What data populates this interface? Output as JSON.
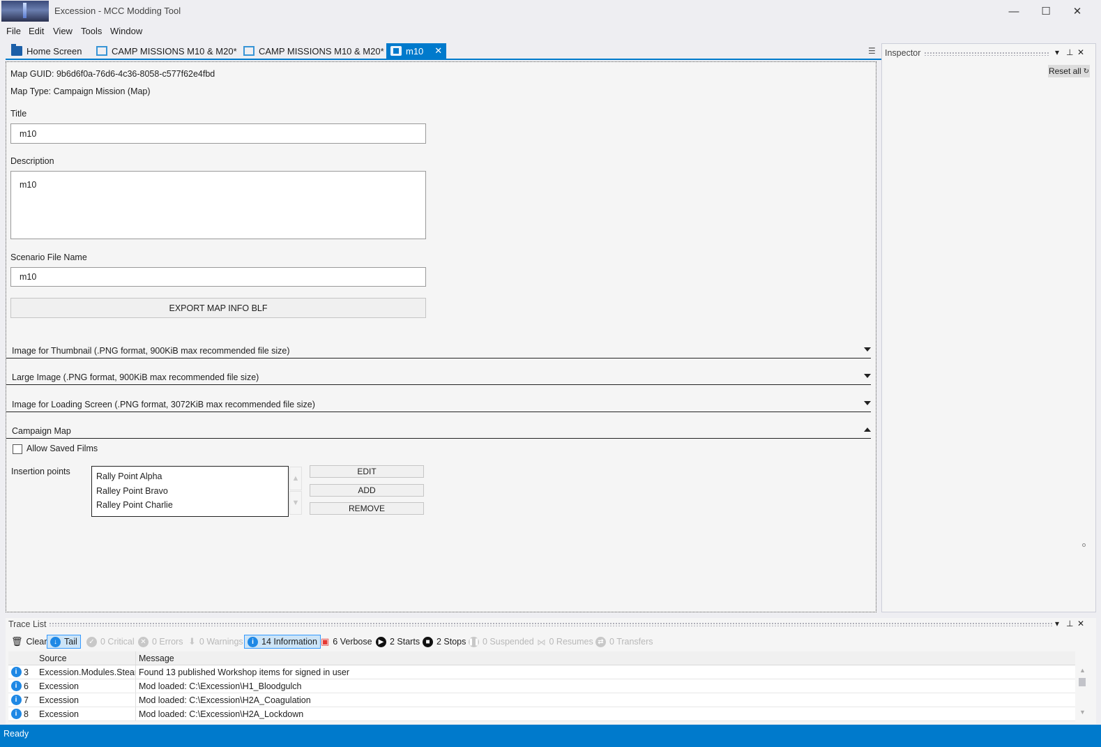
{
  "window": {
    "title": "Excession - MCC Modding Tool",
    "controls": {
      "minimize": "—",
      "maximize": "☐",
      "close": "✕"
    }
  },
  "menu": [
    "File",
    "Edit",
    "View",
    "Tools",
    "Window"
  ],
  "tabs": [
    {
      "label": "Home Screen",
      "icon": "folder-icon"
    },
    {
      "label": "CAMP MISSIONS M10 & M20*",
      "icon": "package-icon"
    },
    {
      "label": "CAMP MISSIONS M10 & M20*",
      "icon": "package-icon"
    },
    {
      "label": "m10",
      "icon": "puzzle-icon",
      "active": true
    }
  ],
  "map": {
    "guid": "Map GUID: 9b6d6f0a-76d6-4c36-8058-c577f62e4fbd",
    "type": "Map Type: Campaign Mission (Map)",
    "title_label": "Title",
    "title_value": "m10",
    "description_label": "Description",
    "description_value": "m10",
    "scenario_label": "Scenario File Name",
    "scenario_value": "m10",
    "export_label": "EXPORT MAP INFO BLF"
  },
  "sections": [
    {
      "label": "Image for Thumbnail (.PNG format, 900KiB max recommended file size)",
      "expanded": false
    },
    {
      "label": "Large Image (.PNG format, 900KiB max recommended file size)",
      "expanded": false
    },
    {
      "label": "Image for Loading Screen (.PNG format, 3072KiB max recommended file size)",
      "expanded": false
    },
    {
      "label": "Campaign Map",
      "expanded": true
    }
  ],
  "campaign": {
    "allow_saved_films": "Allow Saved Films",
    "insertion_label": "Insertion points",
    "insertion_points": [
      "Rally Point Alpha",
      "Ralley Point Bravo",
      "Ralley Point Charlie"
    ],
    "edit": "EDIT",
    "add": "ADD",
    "remove": "REMOVE"
  },
  "inspector": {
    "title": "Inspector",
    "reset_all": "Reset all"
  },
  "trace": {
    "title": "Trace List",
    "toolbar": {
      "clear": "Clear",
      "tail": "Tail",
      "critical": "0 Critical",
      "errors": "0 Errors",
      "warnings": "0 Warnings",
      "information": "14 Information",
      "verbose": "6 Verbose",
      "starts": "2 Starts",
      "stops": "2 Stops",
      "suspended": "0 Suspended",
      "resumes": "0 Resumes",
      "transfers": "0 Transfers"
    },
    "columns": {
      "source": "Source",
      "message": "Message"
    },
    "rows": [
      {
        "id": "3",
        "source": "Excession.Modules.Steam",
        "message": "Found 13 published Workshop items for signed in user"
      },
      {
        "id": "6",
        "source": "Excession",
        "message": "Mod loaded: C:\\Excession\\H1_Bloodgulch"
      },
      {
        "id": "7",
        "source": "Excession",
        "message": "Mod loaded: C:\\Excession\\H2A_Coagulation"
      },
      {
        "id": "8",
        "source": "Excession",
        "message": "Mod loaded: C:\\Excession\\H2A_Lockdown"
      }
    ]
  },
  "status": {
    "text": "Ready"
  },
  "colors": {
    "accent": "#007acc",
    "background": "#eeeef2",
    "info": "#1e88e5"
  }
}
